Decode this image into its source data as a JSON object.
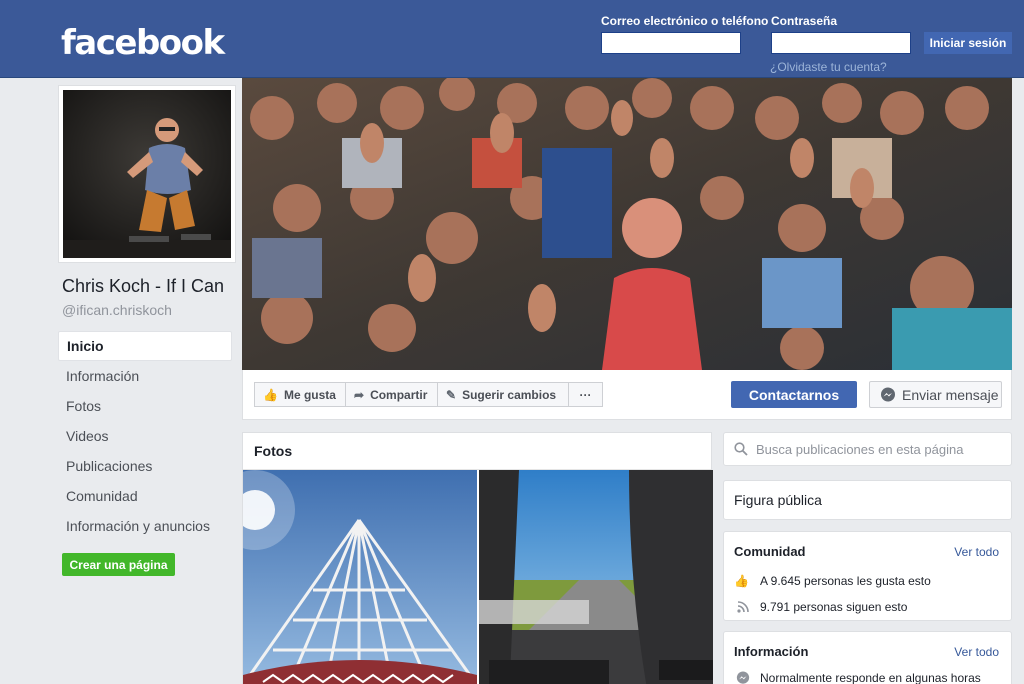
{
  "header": {
    "logo": "facebook",
    "email_label": "Correo electrónico o teléfono",
    "password_label": "Contraseña",
    "login_button": "Iniciar sesión",
    "forgot_link": "¿Olvidaste tu cuenta?"
  },
  "profile": {
    "name": "Chris Koch - If I Can",
    "handle": "@ifican.chriskoch"
  },
  "sidebar": {
    "items": [
      {
        "label": "Inicio"
      },
      {
        "label": "Información"
      },
      {
        "label": "Fotos"
      },
      {
        "label": "Videos"
      },
      {
        "label": "Publicaciones"
      },
      {
        "label": "Comunidad"
      },
      {
        "label": "Información y anuncios"
      }
    ],
    "create_page": "Crear una página"
  },
  "actions": {
    "like": "Me gusta",
    "share": "Compartir",
    "suggest": "Sugerir cambios",
    "more": "···",
    "contact": "Contactarnos",
    "message": "Enviar mensaje"
  },
  "photos": {
    "title": "Fotos"
  },
  "right": {
    "search_placeholder": "Busca publicaciones en esta página",
    "category": "Figura pública",
    "community": {
      "title": "Comunidad",
      "see_all": "Ver todo",
      "likes": "A 9.645 personas les gusta esto",
      "follows": "9.791 personas siguen esto"
    },
    "info": {
      "title": "Información",
      "see_all": "Ver todo",
      "response": "Normalmente responde en algunas horas"
    }
  },
  "colors": {
    "brand": "#3b5998",
    "button_blue": "#4267b2",
    "green": "#42b72a",
    "page_bg": "#e9ebee"
  }
}
